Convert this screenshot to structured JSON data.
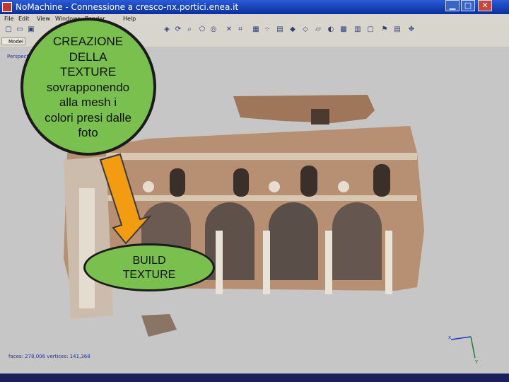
{
  "window": {
    "title": "NoMachine - Connessione a cresco-nx.portici.enea.it",
    "minimize": "▁",
    "maximize": "□",
    "close": "✕"
  },
  "menu": {
    "items": [
      "File",
      "Edit",
      "View",
      "Windows",
      "Render",
      "Help"
    ]
  },
  "toolbar": {
    "icons": [
      "new-icon",
      "open-icon",
      "save-icon",
      "snapshot-icon",
      "layers-icon",
      "undo-icon",
      "redo-icon",
      "cut-icon",
      "pointer-icon",
      "rotate-icon",
      "zoom-icon",
      "measure-icon",
      "select-icon",
      "crop-icon",
      "grid-icon",
      "points-icon",
      "wire-icon",
      "solid-icon",
      "texture-icon",
      "flat-icon",
      "light-icon",
      "camera-icon",
      "flag-icon",
      "axis-icon"
    ]
  },
  "panel": {
    "model_tab": "Model"
  },
  "viewport": {
    "label": "Perspective"
  },
  "status": {
    "text": "faces: 278,006 vertices: 141,368"
  },
  "axis": {
    "x_label": "x",
    "y_label": "Y"
  },
  "callouts": {
    "top": [
      "CREAZIONE",
      "DELLA",
      "TEXTURE",
      "sovrapponendo",
      "alla mesh i",
      "colori presi dalle",
      "foto"
    ],
    "bottom": [
      "BUILD",
      "TEXTURE"
    ]
  },
  "colors": {
    "callout_fill": "#79c04f",
    "arrow_fill": "#f39c12",
    "viewport_bg": "#c6c6c6",
    "titlebar": "#1d45c2"
  }
}
